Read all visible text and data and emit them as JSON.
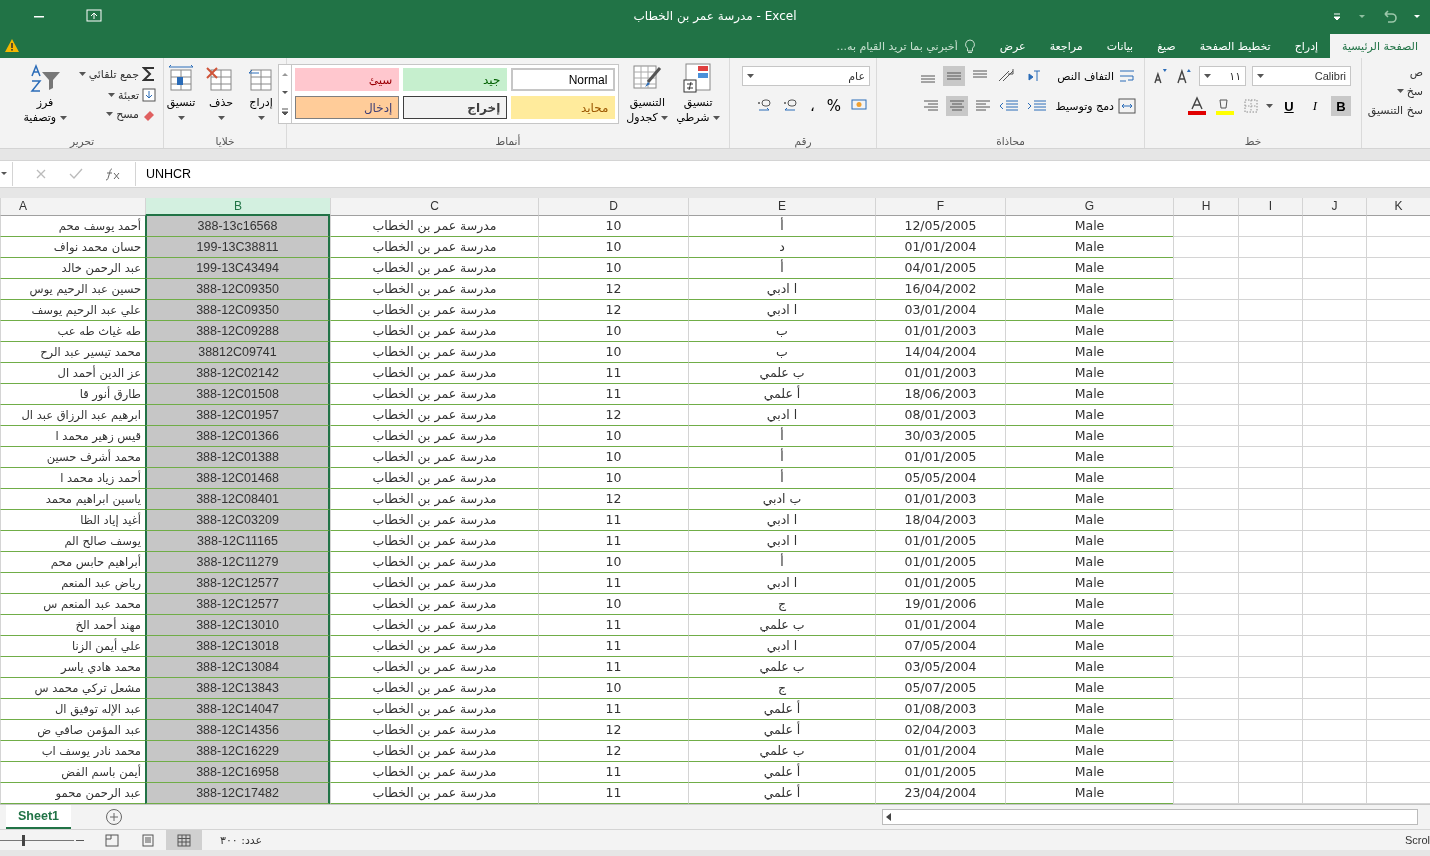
{
  "window": {
    "title": "مدرسة عمر بن الخطاب - Excel"
  },
  "tabs": [
    {
      "label": "الصفحة الرئيسية",
      "selected": true
    },
    {
      "label": "إدراج",
      "selected": false
    },
    {
      "label": "تخطيط الصفحة",
      "selected": false
    },
    {
      "label": "صيغ",
      "selected": false
    },
    {
      "label": "بيانات",
      "selected": false
    },
    {
      "label": "مراجعة",
      "selected": false
    },
    {
      "label": "عرض",
      "selected": false
    }
  ],
  "tell_me": {
    "placeholder": "أخبرني بما تريد القيام به..."
  },
  "ribbon": {
    "clipboard": {
      "cut": "ص",
      "copy": "سخ",
      "format_painter": "سخ التنسيق"
    },
    "font": {
      "name": "Calibri",
      "size": "١١",
      "bold": "B",
      "italic": "I",
      "underline": "U",
      "label": "خط"
    },
    "alignment": {
      "wrap": "التفاف النص",
      "merge": "دمج وتوسيط",
      "label": "محاذاة"
    },
    "number": {
      "format": "عام",
      "percent": "%",
      "comma": "،",
      "label": "رقم"
    },
    "styles": {
      "conditional": [
        "تنسيق",
        "شرطي"
      ],
      "as_table": [
        "التنسيق",
        "كجدول"
      ],
      "label": "أنماط",
      "cells": [
        {
          "label": "Normal",
          "kind": "normal"
        },
        {
          "label": "جيد",
          "kind": "good"
        },
        {
          "label": "سيئ",
          "kind": "bad"
        },
        {
          "label": "محايد",
          "kind": "neutral"
        },
        {
          "label": "إخراج",
          "kind": "output"
        },
        {
          "label": "إدخال",
          "kind": "input"
        }
      ]
    },
    "cells": {
      "buttons": [
        "إدراج",
        "حذف",
        "تنسيق"
      ],
      "label": "خلايا"
    },
    "editing": {
      "autosum": "جمع تلقائي",
      "fill": "تعبئة",
      "clear": "مسح",
      "sort": [
        "فرز",
        "وتصفية"
      ],
      "label": "تحرير"
    }
  },
  "formula_bar": {
    "value": "UNHCR"
  },
  "columns": [
    {
      "label": "K",
      "selected": false
    },
    {
      "label": "J",
      "selected": false
    },
    {
      "label": "I",
      "selected": false
    },
    {
      "label": "H",
      "selected": false
    },
    {
      "label": "G",
      "selected": false
    },
    {
      "label": "F",
      "selected": false
    },
    {
      "label": "E",
      "selected": false
    },
    {
      "label": "D",
      "selected": false
    },
    {
      "label": "C",
      "selected": false
    },
    {
      "label": "B",
      "selected": true
    },
    {
      "label": "A",
      "selected": false
    }
  ],
  "rows": [
    [
      "Male",
      "12/05/2005",
      "أ",
      "10",
      "مدرسة عمر بن الخطاب",
      "388-13c16568",
      "أحمد يوسف محم"
    ],
    [
      "Male",
      "01/01/2004",
      "د",
      "10",
      "مدرسة عمر بن الخطاب",
      "199-13C38811",
      "حسان محمد نواف"
    ],
    [
      "Male",
      "04/01/2005",
      "أ",
      "10",
      "مدرسة عمر بن الخطاب",
      "199-13C43494",
      "عبد الرحمن خالد"
    ],
    [
      "Male",
      "16/04/2002",
      "ا ادبي",
      "12",
      "مدرسة عمر بن الخطاب",
      "388-12C09350",
      "حسين عبد الرحيم يوس"
    ],
    [
      "Male",
      "03/01/2004",
      "ا ادبي",
      "12",
      "مدرسة عمر بن الخطاب",
      "388-12C09350",
      "علي عبد الرحيم يوسف"
    ],
    [
      "Male",
      "01/01/2003",
      "ب",
      "10",
      "مدرسة عمر بن الخطاب",
      "388-12C09288",
      "طه غياث طه عب"
    ],
    [
      "Male",
      "14/04/2004",
      "ب",
      "10",
      "مدرسة عمر بن الخطاب",
      "38812C09741",
      "محمد تيسير عبد الرح"
    ],
    [
      "Male",
      "01/01/2003",
      "ب علمي",
      "11",
      "مدرسة عمر بن الخطاب",
      "388-12C02142",
      "عز الدين أحمد ال"
    ],
    [
      "Male",
      "18/06/2003",
      "أ علمي",
      "11",
      "مدرسة عمر بن الخطاب",
      "388-12C01508",
      "طارق أنور قا"
    ],
    [
      "Male",
      "08/01/2003",
      "ا ادبي",
      "12",
      "مدرسة عمر بن الخطاب",
      "388-12C01957",
      "ابرهيم عبد الرزاق عبد ال"
    ],
    [
      "Male",
      "30/03/2005",
      "أ",
      "10",
      "مدرسة عمر بن الخطاب",
      "388-12C01366",
      "قيس زهير محمد ا"
    ],
    [
      "Male",
      "01/01/2005",
      "أ",
      "10",
      "مدرسة عمر بن الخطاب",
      "388-12C01388",
      "محمد أشرف حسين"
    ],
    [
      "Male",
      "05/05/2004",
      "أ",
      "10",
      "مدرسة عمر بن الخطاب",
      "388-12C01468",
      "أحمد زياد محمد ا"
    ],
    [
      "Male",
      "01/01/2003",
      "ب ادبي",
      "12",
      "مدرسة عمر بن الخطاب",
      "388-12C08401",
      "ياسين ابراهيم محمد"
    ],
    [
      "Male",
      "18/04/2003",
      "ا ادبي",
      "11",
      "مدرسة عمر بن الخطاب",
      "388-12C03209",
      "أغيد إياد الظا"
    ],
    [
      "Male",
      "01/01/2005",
      "ا ادبي",
      "11",
      "مدرسة عمر بن الخطاب",
      "388-12C11165",
      "يوسف صالح الم"
    ],
    [
      "Male",
      "01/01/2005",
      "أ",
      "10",
      "مدرسة عمر بن الخطاب",
      "388-12C11279",
      "أبراهيم حابس محم"
    ],
    [
      "Male",
      "01/01/2005",
      "ا ادبي",
      "11",
      "مدرسة عمر بن الخطاب",
      "388-12C12577",
      "رياض عبد المنعم"
    ],
    [
      "Male",
      "19/01/2006",
      "ج",
      "10",
      "مدرسة عمر بن الخطاب",
      "388-12C12577",
      "محمد عبد المنعم س"
    ],
    [
      "Male",
      "01/01/2004",
      "ب علمي",
      "11",
      "مدرسة عمر بن الخطاب",
      "388-12C13010",
      "مهند أحمد الخ"
    ],
    [
      "Male",
      "07/05/2004",
      "ا ادبي",
      "11",
      "مدرسة عمر بن الخطاب",
      "388-12C13018",
      "علي أيمن الزنا"
    ],
    [
      "Male",
      "03/05/2004",
      "ب علمي",
      "11",
      "مدرسة عمر بن الخطاب",
      "388-12C13084",
      "محمد هادي ياسر"
    ],
    [
      "Male",
      "05/07/2005",
      "ج",
      "10",
      "مدرسة عمر بن الخطاب",
      "388-12C13843",
      "مشعل تركي محمد س"
    ],
    [
      "Male",
      "01/08/2003",
      "أ علمي",
      "11",
      "مدرسة عمر بن الخطاب",
      "388-12C14047",
      "عبد الإله توفيق ال"
    ],
    [
      "Male",
      "02/04/2003",
      "أ علمي",
      "12",
      "مدرسة عمر بن الخطاب",
      "388-12C14356",
      "عبد المؤمن صافي ض"
    ],
    [
      "Male",
      "01/01/2004",
      "ب علمي",
      "12",
      "مدرسة عمر بن الخطاب",
      "388-12C16229",
      "محمد نادر يوسف اب"
    ],
    [
      "Male",
      "01/01/2005",
      "أ علمي",
      "11",
      "مدرسة عمر بن الخطاب",
      "388-12C16958",
      "أيمن باسم الفض"
    ],
    [
      "Male",
      "23/04/2004",
      "أ علمي",
      "11",
      "مدرسة عمر بن الخطاب",
      "388-12C17482",
      "عبد الرحمن محمو"
    ]
  ],
  "sheets": [
    {
      "label": "Sheet1",
      "selected": true
    }
  ],
  "status_bar": {
    "count": "عدد: ٣٠٠",
    "scroll": "Scrol",
    "zoom": {
      "level": 0.3
    },
    "views": [
      {
        "kind": "page_break",
        "selected": false
      },
      {
        "kind": "page_layout",
        "selected": false
      },
      {
        "kind": "normal",
        "selected": true
      }
    ]
  }
}
